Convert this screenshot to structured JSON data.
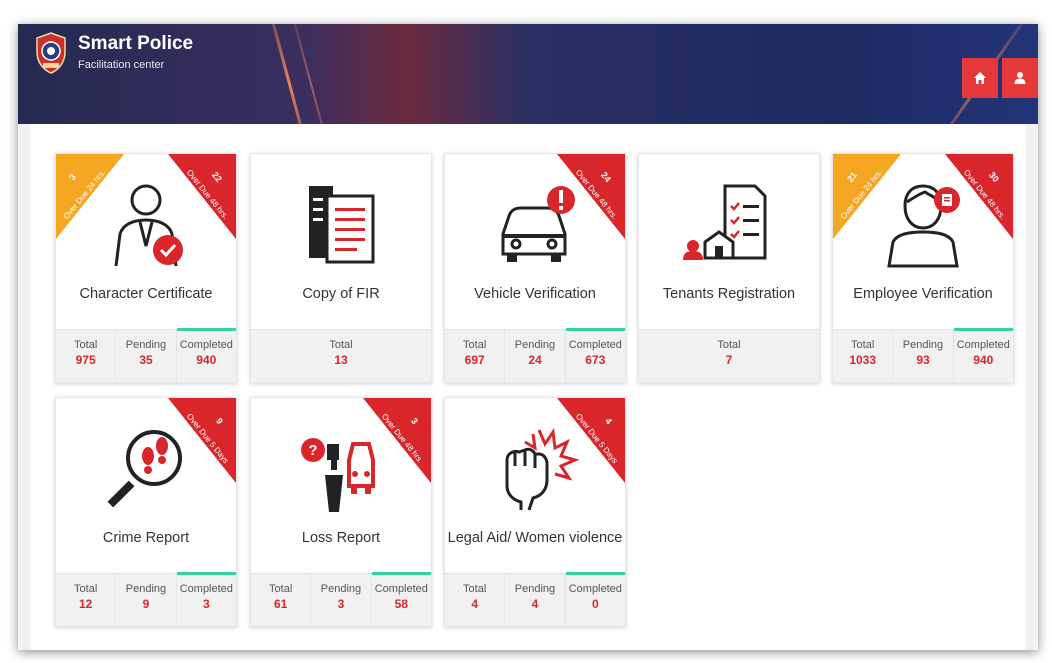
{
  "header": {
    "title": "Smart Police",
    "subtitle": "Facilitation center",
    "home_icon": "home-icon",
    "user_icon": "user-icon",
    "accent": "#e5383b"
  },
  "cards": [
    {
      "label": "Character Certificate",
      "icon": "person-certificate-icon",
      "left_badge": {
        "count": "3",
        "text": "Over Due 24 hrs."
      },
      "right_badge": {
        "count": "22",
        "text": "Over Due 48 hrs."
      },
      "stats": [
        {
          "name": "Total",
          "value": "975"
        },
        {
          "name": "Pending",
          "value": "35"
        },
        {
          "name": "Completed",
          "value": "940"
        }
      ]
    },
    {
      "label": "Copy of FIR",
      "icon": "document-copy-icon",
      "stats": [
        {
          "name": "Total",
          "value": "13"
        }
      ]
    },
    {
      "label": "Vehicle Verification",
      "icon": "car-alert-icon",
      "right_badge": {
        "count": "24",
        "text": "Over Due 48 hrs."
      },
      "stats": [
        {
          "name": "Total",
          "value": "697"
        },
        {
          "name": "Pending",
          "value": "24"
        },
        {
          "name": "Completed",
          "value": "673"
        }
      ]
    },
    {
      "label": "Tenants Registration",
      "icon": "house-checklist-icon",
      "stats": [
        {
          "name": "Total",
          "value": "7"
        }
      ]
    },
    {
      "label": "Employee Verification",
      "icon": "employee-id-icon",
      "left_badge": {
        "count": "21",
        "text": "Over Due 24 hrs."
      },
      "right_badge": {
        "count": "30",
        "text": "Over Due 48 hrs."
      },
      "stats": [
        {
          "name": "Total",
          "value": "1033"
        },
        {
          "name": "Pending",
          "value": "93"
        },
        {
          "name": "Completed",
          "value": "940"
        }
      ]
    },
    {
      "label": "Crime Report",
      "icon": "magnifier-footprints-icon",
      "right_badge": {
        "count": "9",
        "text": "Over Due 5 Days"
      },
      "stats": [
        {
          "name": "Total",
          "value": "12"
        },
        {
          "name": "Pending",
          "value": "9"
        },
        {
          "name": "Completed",
          "value": "3"
        }
      ]
    },
    {
      "label": "Loss Report",
      "icon": "lost-items-icon",
      "right_badge": {
        "count": "3",
        "text": "Over Due 48 hrs."
      },
      "stats": [
        {
          "name": "Total",
          "value": "61"
        },
        {
          "name": "Pending",
          "value": "3"
        },
        {
          "name": "Completed",
          "value": "58"
        }
      ]
    },
    {
      "label": "Legal Aid/ Women violence",
      "icon": "fist-impact-icon",
      "right_badge": {
        "count": "4",
        "text": "Over Due 5 Days"
      },
      "stats": [
        {
          "name": "Total",
          "value": "4"
        },
        {
          "name": "Pending",
          "value": "4"
        },
        {
          "name": "Completed",
          "value": "0"
        }
      ]
    }
  ],
  "colors": {
    "badge_red": "#d9262b",
    "badge_yellow": "#f5a623",
    "value_red": "#d9262b",
    "completed_bar": "#36d399"
  }
}
